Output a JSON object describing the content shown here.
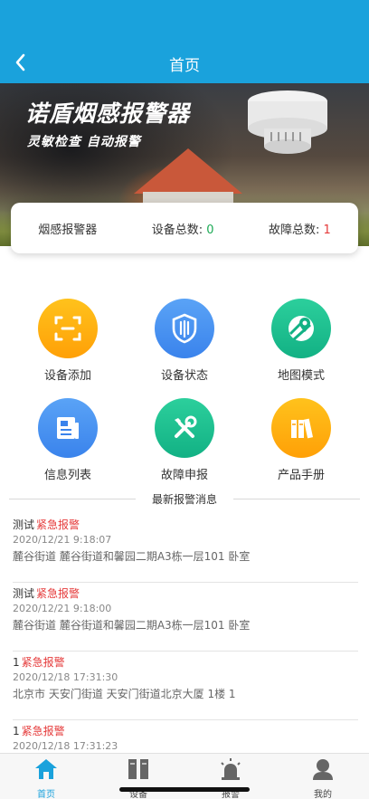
{
  "header": {
    "title": "首页"
  },
  "banner": {
    "title": "诺盾烟感报警器",
    "subtitle": "灵敏检查 自动报警"
  },
  "stats": {
    "device_type": "烟感报警器",
    "total_label": "设备总数:",
    "total_value": "0",
    "fault_label": "故障总数:",
    "fault_value": "1"
  },
  "menu": [
    {
      "label": "设备添加",
      "icon": "scan-icon"
    },
    {
      "label": "设备状态",
      "icon": "shield-icon"
    },
    {
      "label": "地图模式",
      "icon": "map-icon"
    },
    {
      "label": "信息列表",
      "icon": "document-list-icon"
    },
    {
      "label": "故障申报",
      "icon": "tools-icon"
    },
    {
      "label": "产品手册",
      "icon": "books-icon"
    }
  ],
  "alerts_section": {
    "title": "最新报警消息"
  },
  "alerts": [
    {
      "name": "测试",
      "kind": "紧急报警",
      "time": "2020/12/21 9:18:07",
      "address": "麓谷街道 麓谷街道和馨园二期A3栋一层101 卧室"
    },
    {
      "name": "测试",
      "kind": "紧急报警",
      "time": "2020/12/21 9:18:00",
      "address": "麓谷街道 麓谷街道和馨园二期A3栋一层101 卧室"
    },
    {
      "name": "1",
      "kind": "紧急报警",
      "time": "2020/12/18 17:31:30",
      "address": "北京市 天安门街道 天安门街道北京大厦 1楼 1"
    },
    {
      "name": "1",
      "kind": "紧急报警",
      "time": "2020/12/18 17:31:23",
      "address": ""
    }
  ],
  "tabs": [
    {
      "label": "首页",
      "icon": "home-icon",
      "active": true
    },
    {
      "label": "设备",
      "icon": "device-icon"
    },
    {
      "label": "报警",
      "icon": "alarm-icon"
    },
    {
      "label": "我的",
      "icon": "profile-icon"
    }
  ],
  "colors": {
    "primary": "#1aa2dc",
    "alert_red": "#e53a3a",
    "ok_green": "#1caa55"
  }
}
